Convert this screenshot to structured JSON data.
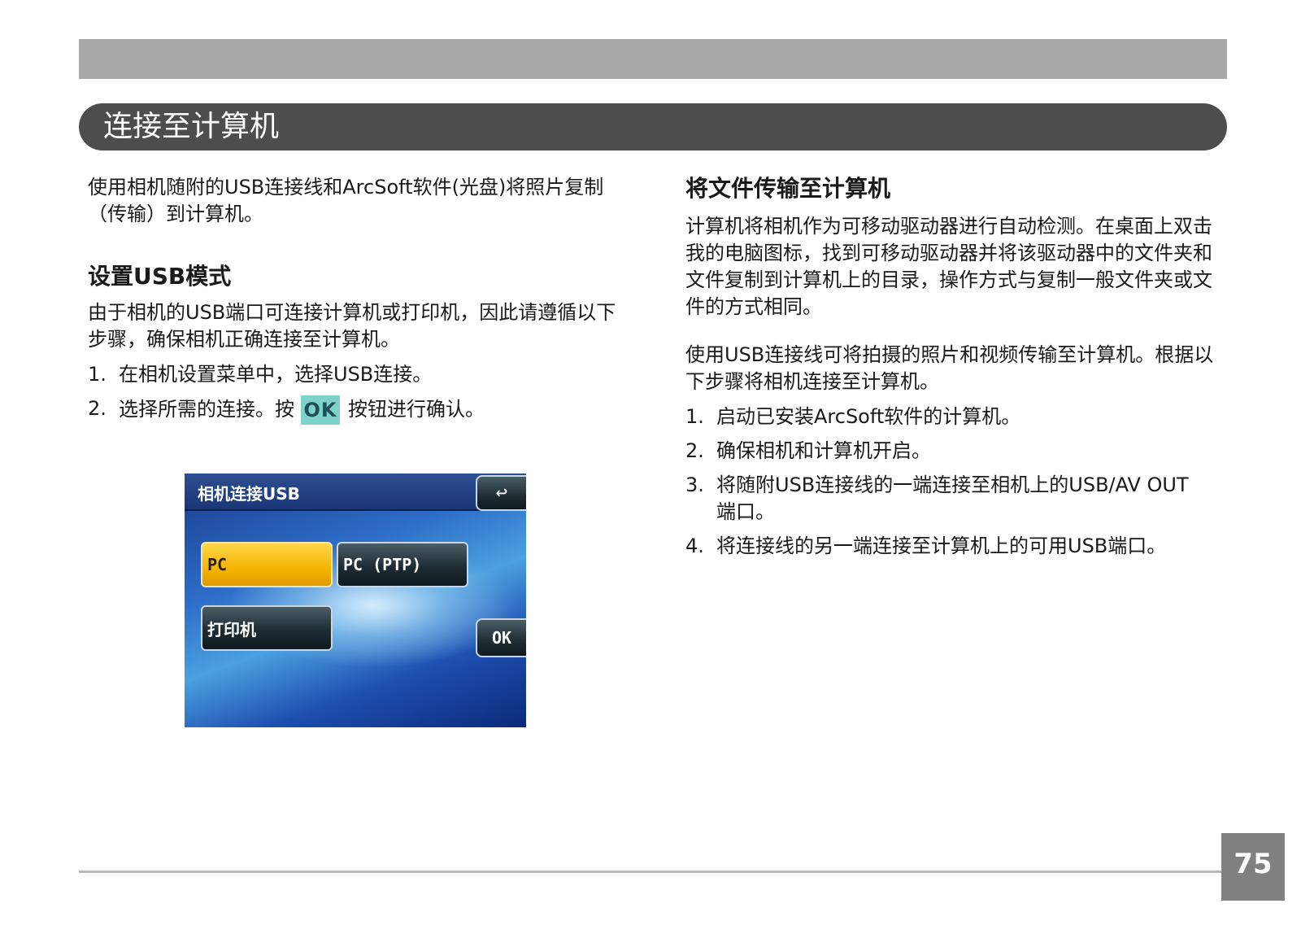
{
  "page": {
    "title": "连接至计算机",
    "page_number": "75"
  },
  "left": {
    "intro": "使用相机随附的USB连接线和ArcSoft软件(光盘)将照片复制（传输）到计算机。",
    "usb_heading": "设置USB模式",
    "usb_para": "由于相机的USB端口可连接计算机或打印机，因此请遵循以下步骤，确保相机正确连接至计算机。",
    "steps": [
      {
        "num": "1.",
        "text": "在相机设置菜单中，选择USB连接。"
      },
      {
        "num": "2.",
        "text_before": "选择所需的连接。按",
        "icon_label": "OK",
        "text_after": "按钮进行确认。"
      }
    ]
  },
  "camera": {
    "title": "相机连接USB",
    "back_icon": "↩",
    "options": [
      "PC",
      "PC (PTP)",
      "打印机"
    ],
    "selected": "PC",
    "ok_label": "OK"
  },
  "right": {
    "heading": "将文件传输至计算机",
    "para1": "计算机将相机作为可移动驱动器进行自动检测。在桌面上双击我的电脑图标，找到可移动驱动器并将该驱动器中的文件夹和文件复制到计算机上的目录，操作方式与复制一般文件夹或文件的方式相同。",
    "para2": "使用USB连接线可将拍摄的照片和视频传输至计算机。根据以下步骤将相机连接至计算机。",
    "steps": [
      {
        "num": "1.",
        "text": "启动已安装ArcSoft软件的计算机。"
      },
      {
        "num": "2.",
        "text": "确保相机和计算机开启。"
      },
      {
        "num": "3.",
        "text": "将随附USB连接线的一端连接至相机上的USB/AV OUT端口。"
      },
      {
        "num": "4.",
        "text": "将连接线的另一端连接至计算机上的可用USB端口。"
      }
    ]
  },
  "colors": {
    "top_band": "#a8a8a8",
    "title_bar": "#4d4d4d",
    "ok_icon_bg": "#7fd1cc",
    "selected_option": "#f5b400",
    "page_number_bg": "#808080"
  }
}
